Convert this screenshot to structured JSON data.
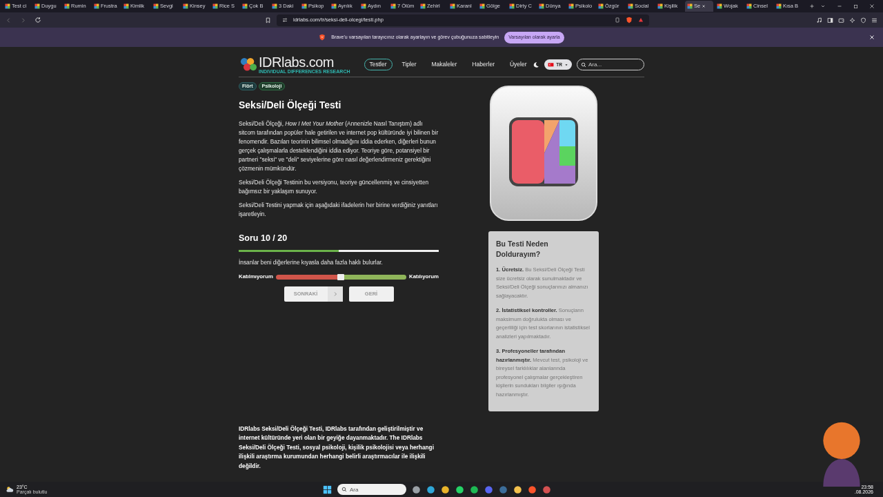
{
  "browser": {
    "tabs": [
      {
        "title": "Test ci",
        "selected": false
      },
      {
        "title": "Duygu",
        "selected": false
      },
      {
        "title": "Rumin",
        "selected": false
      },
      {
        "title": "Frustra",
        "selected": false
      },
      {
        "title": "Kimlik",
        "selected": false
      },
      {
        "title": "Sevgi",
        "selected": false
      },
      {
        "title": "Kinsey",
        "selected": false
      },
      {
        "title": "Rice S",
        "selected": false
      },
      {
        "title": "Çok B",
        "selected": false
      },
      {
        "title": "3 Daki",
        "selected": false
      },
      {
        "title": "Psikop",
        "selected": false
      },
      {
        "title": "Ayrılık",
        "selected": false
      },
      {
        "title": "Aydın",
        "selected": false
      },
      {
        "title": "7 Ölüm",
        "selected": false
      },
      {
        "title": "Zehirl",
        "selected": false
      },
      {
        "title": "Karanl",
        "selected": false
      },
      {
        "title": "Gölge",
        "selected": false
      },
      {
        "title": "Dirty C",
        "selected": false
      },
      {
        "title": "Dünya",
        "selected": false
      },
      {
        "title": "Psikolo",
        "selected": false
      },
      {
        "title": "Özgür",
        "selected": false
      },
      {
        "title": "Social",
        "selected": false
      },
      {
        "title": "Kişilik",
        "selected": false
      },
      {
        "title": "Se",
        "selected": true
      },
      {
        "title": "Wojak",
        "selected": false
      },
      {
        "title": "Cinsel",
        "selected": false
      },
      {
        "title": "Kısa B",
        "selected": false
      }
    ],
    "url": "idrlabs.com/tr/seksi-deli-olcegi/testi.php",
    "notice": {
      "text": "Brave'u varsayılan tarayıcınız olarak ayarlayın ve görev çubuğunuza sabitleyin",
      "button": "Varsayılan olarak ayarla"
    }
  },
  "site": {
    "logo": "IDRlabs.com",
    "logo_tagline": "INDIVIDUAL DIFFERENCES RESEARCH",
    "nav": [
      {
        "label": "Testler",
        "selected": true
      },
      {
        "label": "Tipler",
        "selected": false
      },
      {
        "label": "Makaleler",
        "selected": false
      },
      {
        "label": "Haberler",
        "selected": false
      },
      {
        "label": "Üyeler",
        "selected": false
      }
    ],
    "language": "TR",
    "search": {
      "placeholder": "Ara..."
    }
  },
  "article": {
    "tags": [
      "Flört",
      "Psikoloji"
    ],
    "title": "Seksi/Deli Ölçeği Testi",
    "paragraphs": [
      "Seksi/Deli Ölçeği, *How I Met Your Mother* (Annenizle Nasıl Tanıştım) adlı sitcom tarafından popüler hale getirilen ve internet pop kültüründe iyi bilinen bir fenomendir. Bazıları teorinin bilimsel olmadığını iddia ederken, diğerleri bunun gerçek çalışmalarla desteklendiğini iddia ediyor. Teoriye göre, potansiyel bir partneri \"seksi\" ve \"deli\" seviyelerine göre nasıl değerlendirmeniz gerektiğini çözmenin mümkündür.",
      "Seksi/Deli Ölçeği Testinin bu versiyonu, teoriye güncellenmiş ve cinsiyetten bağımsız bir yaklaşım sunuyor.",
      "Seksi/Deli Testini yapmak için aşağıdaki ifadelerin her birine verdiğiniz yanıtları işaretleyin."
    ],
    "question_counter": "Soru 10 / 20",
    "progress": {
      "level": 0.5
    },
    "question": "İnsanlar beni diğerlerine kıyasla daha fazla haklı bulurlar.",
    "scale": {
      "left_label": "Katılmıyorum",
      "right_label": "Katılıyorum",
      "level": 0.5
    },
    "next_button": "SONRAKİ",
    "back_button": "GERİ",
    "disclaimer": "IDRlabs Seksi/Deli Ölçeği Testi, IDRlabs tarafından geliştirilmiştir ve internet kültüründe yeri olan bir geyiğe dayanmaktadır. The IDRlabs Seksi/Deli Ölçeği Testi, sosyal psikoloji, kişilik psikolojisi veya herhangi ilişkili araştırma kurumundan herhangi belirli araştırmacılar ile ilişkili değildir."
  },
  "sidebar": {
    "title": "Bu Testi Neden Doldurayım?",
    "points": [
      {
        "heading": "1. Ücretsiz.",
        "text": "Bu Seksi/Deli Ölçeği Testi size ücretsiz olarak sunulmaktadır ve Seksi/Deli Ölçeği sonuçlarınızı almanızı sağlayacaktır."
      },
      {
        "heading": "2. İstatistiksel kontroller.",
        "text": "Sonuçların maksimum doğrulukta olması ve geçerliliği için test skorlarının istatistiksel analizleri yapılmaktadır."
      },
      {
        "heading": "3. Profesyoneller tarafından hazırlanmıştır.",
        "text": "Mevcut test, psikoloji ve bireysel farklılıklar alanlarında profesyonel çalışmalar gerçekleştiren kişilerin sundukları bilgiler ışığında hazırlanmıştır."
      }
    ]
  },
  "taskbar": {
    "temperature": "23°C",
    "weather": "Parçalı bulutlu",
    "search": {
      "placeholder": "Ara"
    },
    "time": "23:58",
    "date": ".08.2026"
  }
}
